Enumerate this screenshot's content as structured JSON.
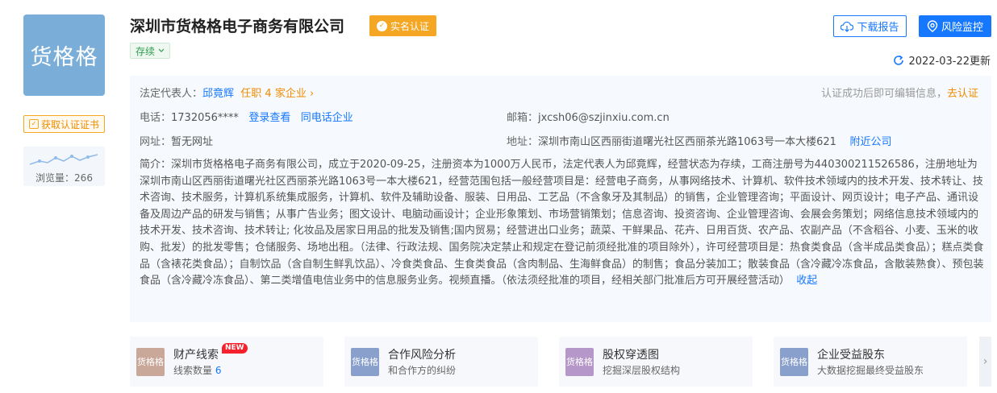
{
  "logo_text": "货格格",
  "certificate_button": "获取认证证书",
  "views_label": "浏览量：266",
  "company": {
    "name": "深圳市货格格电子商务有限公司",
    "verified": "实名认证",
    "status": "存续"
  },
  "actions": {
    "download": "下载报告",
    "monitor": "风险监控"
  },
  "update_time": "2022-03-22更新",
  "info": {
    "legal_label": "法定代表人：",
    "legal_name": "邱竟辉",
    "legal_roles": "任职 4 家企业",
    "edit_hint": "认证成功后即可编辑信息，",
    "edit_link": "去认证",
    "phone_label": "电话：",
    "phone": "1732056****",
    "phone_login": "登录查看",
    "phone_same": "同电话企业",
    "email_label": "邮箱：",
    "email": "jxcsh06@szjinxiu.com.cn",
    "website_label": "网址：",
    "website": "暂无网址",
    "address_label": "地址：",
    "address": "深圳市南山区西丽街道曙光社区西丽茶光路1063号一本大楼621",
    "nearby": "附近公司",
    "intro_label": "简介：",
    "intro": "深圳市货格格电子商务有限公司，成立于2020-09-25，注册资本为1000万人民币，法定代表人为邱竟辉，经营状态为存续，工商注册号为440300211526586，注册地址为深圳市南山区西丽街道曙光社区西丽茶光路1063号一本大楼621，经营范围包括一般经营项目是：经营电子商务，从事网络技术、计算机、软件技术领域内的技术开发、技术转让、技术咨询、技术服务，计算机系统集成服务，计算机、软件及辅助设备、服装、日用品、工艺品（不含象牙及其制品）的销售，企业管理咨询；平面设计、网页设计；电子产品、通讯设备及周边产品的研发与销售；从事广告业务；图文设计、电脑动画设计；企业形象策划、市场营销策划；信息咨询、投资咨询、企业管理咨询、会展会务策划；网络信息技术领域内的技术开发、技术咨询、技术转让; 化妆品及居家日用品的批发及销售;国内贸易；经营进出口业务；蔬菜、干鲜果品、花卉、日用百货、农产品、农副产品（不含稻谷、小麦、玉米的收购、批发）的批发零售；仓储服务、场地出租。（法律、行政法规、国务院决定禁止和规定在登记前须经批准的项目除外），许可经营项目是：热食类食品（含半成品类食品）；糕点类食品（含裱花类食品）；自制饮品（含自制生鲜乳饮品）、冷食类食品、生食类食品（含肉制品、生海鲜食品）的制售；食品分装加工；散装食品（含冷藏冷冻食品，含散装熟食）、预包装食品（含冷藏冷冻食品）、第二类增值电信业务中的信息服务业务。视频直播。（依法须经批准的项目，经相关部门批准后方可开展经营活动）",
    "collapse": "收起"
  },
  "cards": [
    {
      "img": "货格格",
      "title": "财产线索",
      "badge": "NEW",
      "sub": "线索数量",
      "sub_num": "6",
      "color": "#c9a89a"
    },
    {
      "img": "货格格",
      "title": "合作风险分析",
      "sub": "和合作方的纠纷",
      "color": "#8aa0cc"
    },
    {
      "img": "货格格",
      "title": "股权穿透图",
      "sub": "挖掘深层股权结构",
      "color": "#b597c9"
    },
    {
      "img": "货格格",
      "title": "企业受益股东",
      "sub": "大数据挖掘最终受益股东",
      "color": "#8aa0cc"
    }
  ],
  "colors": {
    "accent": "#1677ff",
    "orange": "#f5a623",
    "status_green": "#2e9e4f"
  }
}
